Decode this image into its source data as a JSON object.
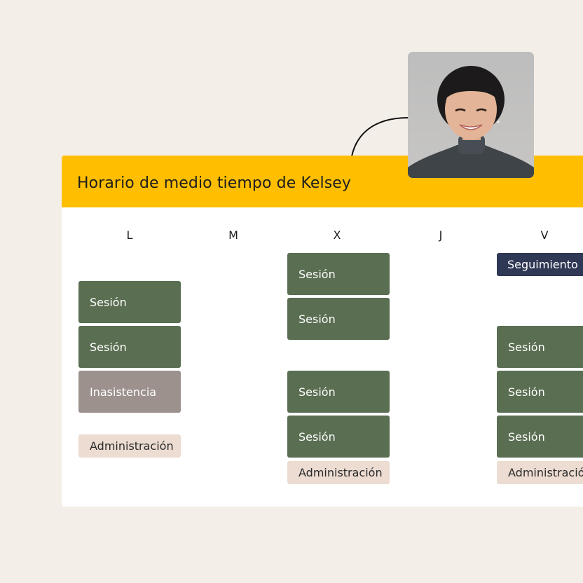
{
  "schedule": {
    "title": "Horario de medio tiempo de Kelsey",
    "days": [
      "L",
      "M",
      "X",
      "J",
      "V"
    ],
    "blocks": {
      "mon": [
        "Sesión",
        "Sesión",
        "Inasistencia",
        "Administración"
      ],
      "wed": [
        "Sesión",
        "Sesión",
        "Sesión",
        "Sesión",
        "Administración"
      ],
      "fri": [
        "Seguimiento",
        "Sesión",
        "Sesión",
        "Sesión",
        "Administración"
      ]
    }
  },
  "colors": {
    "background": "#f4eee8",
    "header": "#ffbf00",
    "session": "#5a6e52",
    "absence": "#9c918d",
    "admin": "#ecdcd1",
    "followup": "#2f3854"
  },
  "avatar": {
    "icon": "person-photo"
  }
}
